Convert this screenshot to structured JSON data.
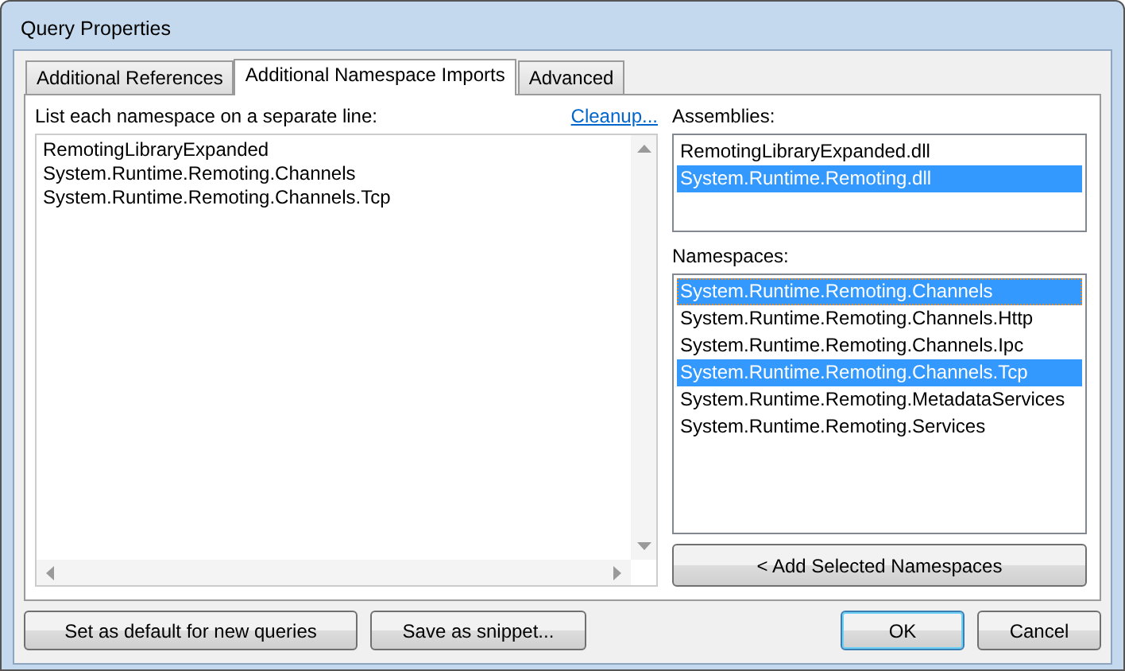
{
  "window": {
    "title": "Query Properties"
  },
  "tabs": [
    {
      "label": "Additional References",
      "selected": false
    },
    {
      "label": "Additional Namespace Imports",
      "selected": true
    },
    {
      "label": "Advanced",
      "selected": false
    }
  ],
  "editor": {
    "label": "List each namespace on a separate line:",
    "link": "Cleanup...",
    "lines": [
      "RemotingLibraryExpanded",
      "System.Runtime.Remoting.Channels",
      "System.Runtime.Remoting.Channels.Tcp"
    ]
  },
  "assemblies": {
    "label": "Assemblies:",
    "items": [
      {
        "text": "RemotingLibraryExpanded.dll",
        "selected": false
      },
      {
        "text": "System.Runtime.Remoting.dll",
        "selected": true
      }
    ]
  },
  "namespaces": {
    "label": "Namespaces:",
    "items": [
      {
        "text": "System.Runtime.Remoting.Channels",
        "selected": true,
        "focused": true
      },
      {
        "text": "System.Runtime.Remoting.Channels.Http",
        "selected": false,
        "focused": false
      },
      {
        "text": "System.Runtime.Remoting.Channels.Ipc",
        "selected": false,
        "focused": false
      },
      {
        "text": "System.Runtime.Remoting.Channels.Tcp",
        "selected": true,
        "focused": false
      },
      {
        "text": "System.Runtime.Remoting.MetadataServices",
        "selected": false,
        "focused": false
      },
      {
        "text": "System.Runtime.Remoting.Services",
        "selected": false,
        "focused": false
      }
    ]
  },
  "add_button": "< Add Selected Namespaces",
  "footer_buttons": [
    {
      "label": "Set as default for new queries",
      "kind": "wide"
    },
    {
      "label": "Save as snippet...",
      "kind": "medium"
    }
  ],
  "dialog_buttons": [
    {
      "label": "OK",
      "default": true
    },
    {
      "label": "Cancel",
      "default": false
    }
  ]
}
